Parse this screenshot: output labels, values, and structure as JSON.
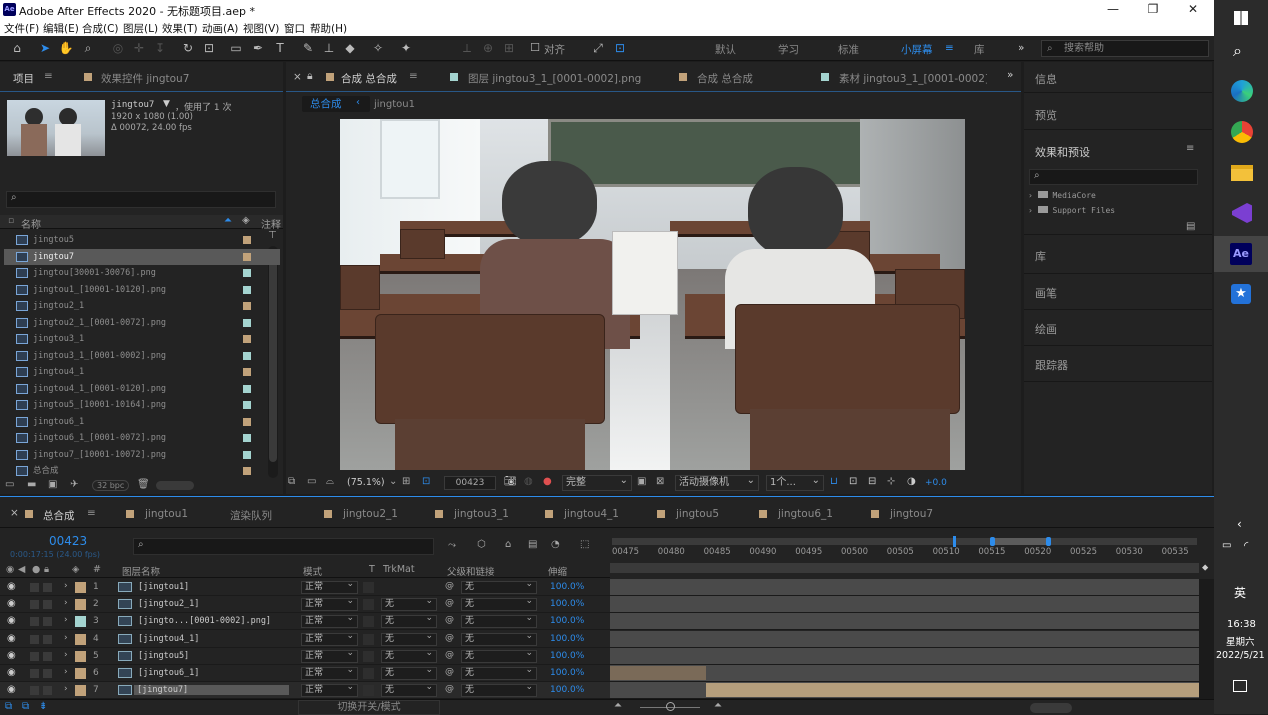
{
  "window": {
    "app_badge": "Ae",
    "title": "Adobe After Effects 2020 - 无标题项目.aep *",
    "minimize": "—",
    "restore": "❐",
    "close": "✕"
  },
  "menu": [
    "文件(F)",
    "编辑(E)",
    "合成(C)",
    "图层(L)",
    "效果(T)",
    "动画(A)",
    "视图(V)",
    "窗口",
    "帮助(H)"
  ],
  "toolbar": {
    "snap_label": "对齐",
    "workspaces": [
      "默认",
      "学习",
      "标准",
      "小屏幕",
      "库"
    ],
    "active_workspace": "小屏幕",
    "search_placeholder": "搜索帮助"
  },
  "project_panel": {
    "tab": "项目",
    "tab2": "效果控件 jingtou7",
    "preview": {
      "name": "jingtou7",
      "used": "，使用了 1 次",
      "res": "1920 x 1080 (1.00)",
      "dur": "Δ 00072, 24.00 fps"
    },
    "search_icon": "⌕",
    "col_name": "名称",
    "col_comment": "注释",
    "items": [
      "jingtou5",
      "jingtou7",
      "jingtou[30001-30076].png",
      "jingtou1_[10001-10120].png",
      "jingtou2_1",
      "jingtou2_1_[0001-0072].png",
      "jingtou3_1",
      "jingtou3_1_[0001-0002].png",
      "jingtou4_1",
      "jingtou4_1_[0001-0120].png",
      "jingtou5_[10001-10164].png",
      "jingtou6_1",
      "jingtou6_1_[0001-0072].png",
      "jingtou7_[10001-10072].png",
      "总合成"
    ],
    "bpc": "32 bpc"
  },
  "comp_tabs": {
    "comp": "合成 总合成",
    "layer": "图层 jingtou3_1_[0001-0002].png",
    "comp2": "合成 总合成",
    "footage": "素材 jingtou3_1_[0001-0002].png"
  },
  "breadcrumb": [
    "总合成",
    "jingtou1"
  ],
  "viewer_bar": {
    "zoom": "(75.1%)",
    "timecode": "00423",
    "resolution": "完整",
    "camera": "活动摄像机",
    "views": "1个...",
    "exposure": "+0.0"
  },
  "right_panel": {
    "items": [
      "信息",
      "预览",
      "效果和预设",
      "库",
      "画笔",
      "绘画",
      "跟踪器"
    ],
    "tree": [
      "MediaCore",
      "Support Files"
    ]
  },
  "timeline": {
    "tabs": [
      "总合成",
      "jingtou1",
      "渲染队列",
      "jingtou2_1",
      "jingtou3_1",
      "jingtou4_1",
      "jingtou5",
      "jingtou6_1",
      "jingtou7"
    ],
    "timecode": "00423",
    "timecode_sub": "0:00:17:15 (24.00 fps)",
    "headers": {
      "layer_name": "图层名称",
      "mode": "模式",
      "t": "T",
      "trkmat": "TrkMat",
      "parent": "父级和链接",
      "stretch": "伸缩"
    },
    "layers": [
      {
        "num": "1",
        "name": "[jingtou1]",
        "mode": "正常",
        "trk": "",
        "parent": "无",
        "stretch": "100.0%",
        "color": "#c1a27a"
      },
      {
        "num": "2",
        "name": "[jingtou2_1]",
        "mode": "正常",
        "trk": "无",
        "parent": "无",
        "stretch": "100.0%",
        "color": "#c1a27a"
      },
      {
        "num": "3",
        "name": "[jingto...[0001-0002].png]",
        "mode": "正常",
        "trk": "无",
        "parent": "无",
        "stretch": "100.0%",
        "color": "#a4d4d0"
      },
      {
        "num": "4",
        "name": "[jingtou4_1]",
        "mode": "正常",
        "trk": "无",
        "parent": "无",
        "stretch": "100.0%",
        "color": "#c1a27a"
      },
      {
        "num": "5",
        "name": "[jingtou5]",
        "mode": "正常",
        "trk": "无",
        "parent": "无",
        "stretch": "100.0%",
        "color": "#c1a27a"
      },
      {
        "num": "6",
        "name": "[jingtou6_1]",
        "mode": "正常",
        "trk": "无",
        "parent": "无",
        "stretch": "100.0%",
        "color": "#c1a27a"
      },
      {
        "num": "7",
        "name": "[jingtou7]",
        "mode": "正常",
        "trk": "无",
        "parent": "无",
        "stretch": "100.0%",
        "color": "#c1a27a"
      }
    ],
    "ruler": [
      "00475",
      "00480",
      "00485",
      "00490",
      "00495",
      "00500",
      "00505",
      "00510",
      "00515",
      "00520",
      "00525",
      "00530",
      "00535"
    ],
    "toggle_label": "切换开关/模式"
  },
  "taskbar": {
    "lang": "英",
    "time": "16:38",
    "weekday": "星期六",
    "date": "2022/5/21"
  }
}
